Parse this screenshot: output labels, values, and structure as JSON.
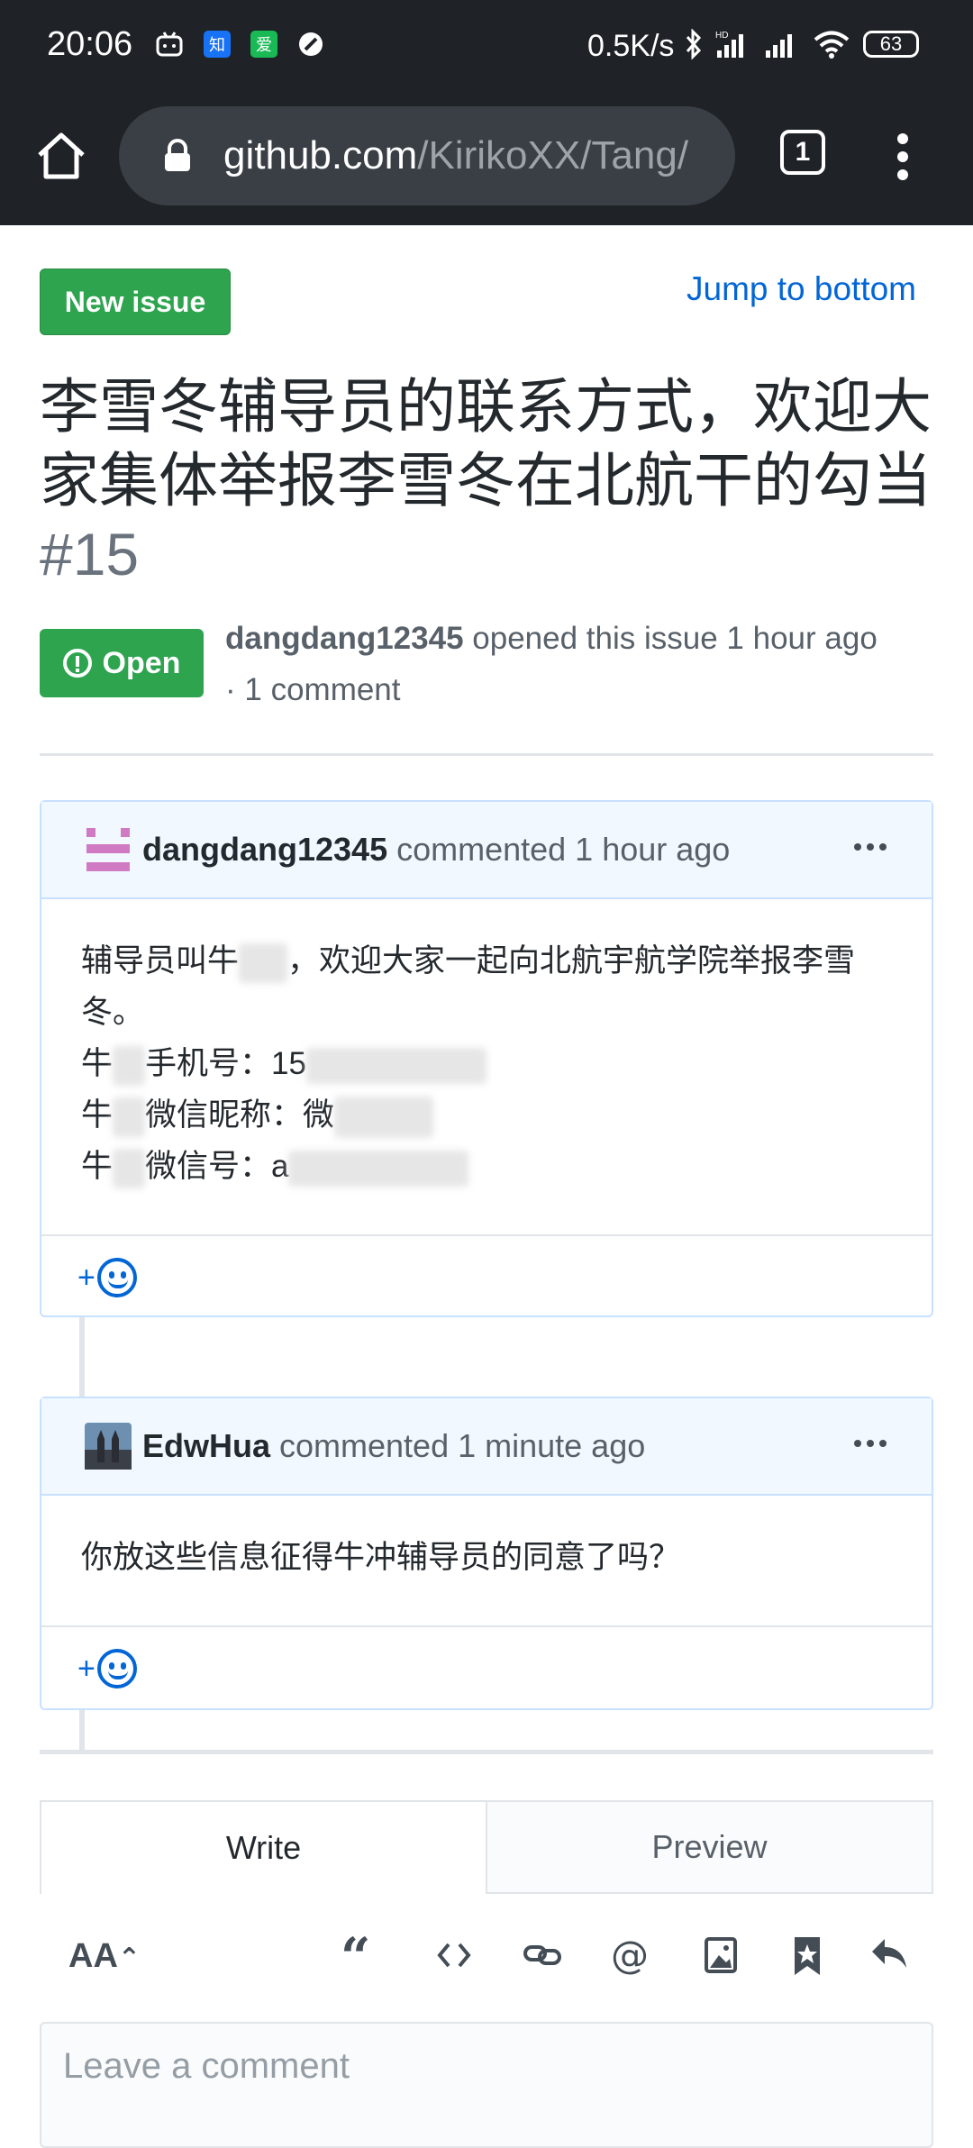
{
  "status": {
    "time": "20:06",
    "speed": "0.5K/s",
    "battery": "63",
    "app_icons": [
      "知",
      "爱"
    ]
  },
  "browser": {
    "url_host": "github.com",
    "url_path": "/KirikoXX/Tang/",
    "tab_count": "1"
  },
  "issue": {
    "new_issue_label": "New issue",
    "jump_label": "Jump to bottom",
    "title": "李雪冬辅导员的联系方式，欢迎大家集体举报李雪冬在北航干的勾当",
    "number": "#15",
    "state": "Open",
    "opener": "dangdang12345",
    "opened_text": "opened this issue 1 hour ago",
    "comment_count": "· 1 comment"
  },
  "comments": [
    {
      "author": "dangdang12345",
      "action": "commented 1 hour ago",
      "lines": [
        "辅导员叫牛",
        "，欢迎大家一起向北航宇航学院举报李雪冬。",
        "牛",
        "手机号：15",
        "牛",
        "微信昵称：微",
        "牛",
        "微信号：a"
      ]
    },
    {
      "author": "EdwHua",
      "action": "commented 1 minute ago",
      "text": "你放这些信息征得牛冲辅导员的同意了吗？"
    }
  ],
  "reaction_plus": "+",
  "editor": {
    "write_tab": "Write",
    "preview_tab": "Preview",
    "text_tool": "AA",
    "placeholder": "Leave a comment"
  },
  "colors": {
    "accent_green": "#2ea44f",
    "link_blue": "#0366d6",
    "topbar": "#1f2328"
  }
}
